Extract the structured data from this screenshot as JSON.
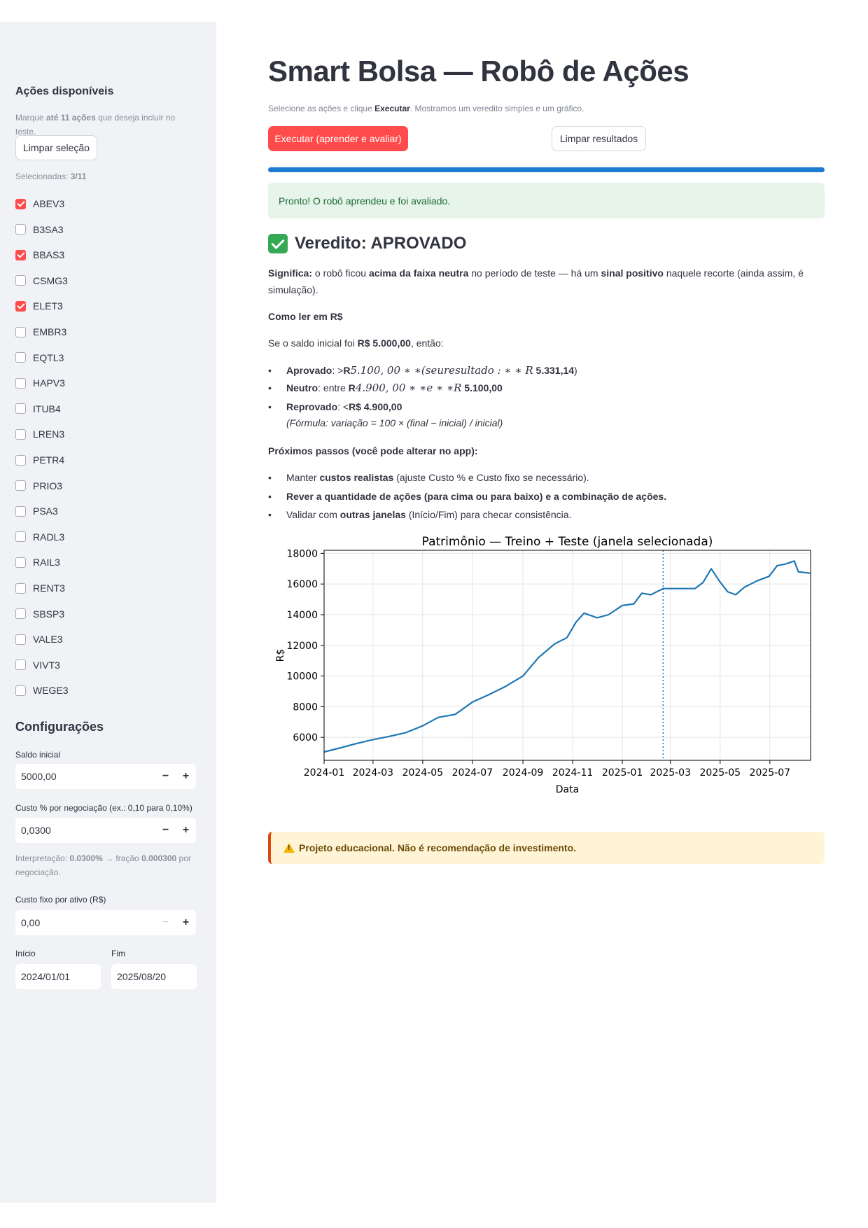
{
  "sidebar": {
    "stocks_header": "Ações disponíveis",
    "hint_prefix": "Marque ",
    "hint_bold": "até 11 ações",
    "hint_suffix": " que deseja incluir no teste.",
    "clear_selection_label": "Limpar seleção",
    "selected_prefix": "Selecionadas: ",
    "selected_count": "3/11",
    "stocks": [
      {
        "ticker": "ABEV3",
        "checked": true
      },
      {
        "ticker": "B3SA3",
        "checked": false
      },
      {
        "ticker": "BBAS3",
        "checked": true
      },
      {
        "ticker": "CSMG3",
        "checked": false
      },
      {
        "ticker": "ELET3",
        "checked": true
      },
      {
        "ticker": "EMBR3",
        "checked": false
      },
      {
        "ticker": "EQTL3",
        "checked": false
      },
      {
        "ticker": "HAPV3",
        "checked": false
      },
      {
        "ticker": "ITUB4",
        "checked": false
      },
      {
        "ticker": "LREN3",
        "checked": false
      },
      {
        "ticker": "PETR4",
        "checked": false
      },
      {
        "ticker": "PRIO3",
        "checked": false
      },
      {
        "ticker": "PSA3",
        "checked": false
      },
      {
        "ticker": "RADL3",
        "checked": false
      },
      {
        "ticker": "RAIL3",
        "checked": false
      },
      {
        "ticker": "RENT3",
        "checked": false
      },
      {
        "ticker": "SBSP3",
        "checked": false
      },
      {
        "ticker": "VALE3",
        "checked": false
      },
      {
        "ticker": "VIVT3",
        "checked": false
      },
      {
        "ticker": "WEGE3",
        "checked": false
      }
    ],
    "config_header": "Configurações",
    "initial_balance_label": "Saldo inicial",
    "initial_balance_value": "5000,00",
    "cost_pct_label": "Custo % por negociação (ex.: 0,10 para 0,10%)",
    "cost_pct_value": "0,0300",
    "interp_prefix": "Interpretação: ",
    "interp_pct": "0.0300%",
    "interp_mid": " → fração ",
    "interp_frac": "0.000300",
    "interp_suffix": " por negociação.",
    "fixed_cost_label": "Custo fixo por ativo (R$)",
    "fixed_cost_value": "0,00",
    "start_label": "Início",
    "start_value": "2024/01/01",
    "end_label": "Fim",
    "end_value": "2025/08/20",
    "minus": "−",
    "plus": "+"
  },
  "main": {
    "title": "Smart Bolsa — Robô de Ações",
    "subtitle_prefix": "Selecione as ações e clique ",
    "subtitle_bold": "Executar",
    "subtitle_suffix": ". Mostramos um veredito simples e um gráfico.",
    "run_button": "Executar (aprender e avaliar)",
    "clear_results_button": "Limpar resultados",
    "progress": 1.0,
    "success_message": "Pronto! O robô aprendeu e foi avaliado.",
    "verdict_title": "Veredito: APROVADO",
    "meaning_label": "Significa:",
    "meaning_1": " o robô ficou ",
    "meaning_bold1": "acima da faixa neutra",
    "meaning_2": " no período de teste — há um ",
    "meaning_bold2": "sinal positivo",
    "meaning_3": " naquele recorte (ainda assim, é simulação).",
    "how_to_read": "Como ler em R$",
    "initial_pre": "Se o saldo inicial foi ",
    "initial_bold": "R$ 5.000,00",
    "initial_post": ", então:",
    "approved_label": "Aprovado",
    "approved_pre": ": >",
    "approved_r": "R",
    "approved_math": "5.100, 00 ∗ ∗(seuresultado : ∗ ∗ R",
    "approved_value": " 5.331,14",
    "approved_close": ")",
    "neutral_label": "Neutro",
    "neutral_pre": ": entre ",
    "neutral_r": "R",
    "neutral_math": "4.900, 00 ∗ ∗e ∗ ∗R",
    "neutral_value": " 5.100,00",
    "rejected_label": "Reprovado",
    "rejected_pre": ": <",
    "rejected_value": "R$ 4.900,00",
    "formula": "(Fórmula: variação = 100 × (final − inicial) / inicial)",
    "next_steps": "Próximos passos (você pode alterar no app):",
    "step1_pre": "Manter ",
    "step1_bold": "custos realistas",
    "step1_post": " (ajuste Custo % e Custo fixo se necessário).",
    "step2": "Rever a quantidade de ações (para cima ou para baixo) e a combinação de ações.",
    "step3_pre": "Validar com ",
    "step3_bold": "outras janelas",
    "step3_post": " (Início/Fim) para checar consistência.",
    "bullet": "•",
    "warning": "Projeto educacional. Não é recomendação de investimento."
  },
  "chart_data": {
    "type": "line",
    "title": "Patrimônio — Treino + Teste (janela selecionada)",
    "xlabel": "Data",
    "ylabel": "R$",
    "x_ticks": [
      "2024-01",
      "2024-03",
      "2024-05",
      "2024-07",
      "2024-09",
      "2024-11",
      "2025-01",
      "2025-03",
      "2025-05",
      "2025-07"
    ],
    "y_ticks": [
      6000,
      8000,
      10000,
      12000,
      14000,
      16000,
      18000
    ],
    "ylim": [
      4500,
      18200
    ],
    "xlim": [
      "2024-01-01",
      "2025-08-20"
    ],
    "grid": true,
    "split_date": "2025-02-20",
    "color": "#1f77b4",
    "split_color": "#1f77b4",
    "series": [
      {
        "x": [
          "2024-01-01",
          "2024-01-20",
          "2024-02-10",
          "2024-03-01",
          "2024-03-20",
          "2024-04-10",
          "2024-05-01",
          "2024-05-20",
          "2024-06-10",
          "2024-07-01",
          "2024-07-20",
          "2024-08-10",
          "2024-09-01",
          "2024-09-20",
          "2024-10-10",
          "2024-10-25",
          "2024-11-05",
          "2024-11-15",
          "2024-12-01",
          "2024-12-15",
          "2025-01-01",
          "2025-01-15",
          "2025-01-25",
          "2025-02-05",
          "2025-02-20",
          "2025-03-10",
          "2025-03-31",
          "2025-04-10",
          "2025-04-20",
          "2025-04-30",
          "2025-05-10",
          "2025-05-20",
          "2025-05-31",
          "2025-06-15",
          "2025-06-30",
          "2025-07-10",
          "2025-07-20",
          "2025-07-31",
          "2025-08-05",
          "2025-08-20"
        ],
        "y": [
          5050,
          5300,
          5600,
          5850,
          6050,
          6300,
          6750,
          7300,
          7500,
          8300,
          8750,
          9300,
          10000,
          11200,
          12100,
          12500,
          13500,
          14100,
          13800,
          14000,
          14600,
          14700,
          15400,
          15300,
          15700,
          15700,
          15700,
          16100,
          17000,
          16200,
          15500,
          15300,
          15800,
          16200,
          16500,
          17200,
          17300,
          17500,
          16800,
          16700
        ]
      }
    ]
  }
}
